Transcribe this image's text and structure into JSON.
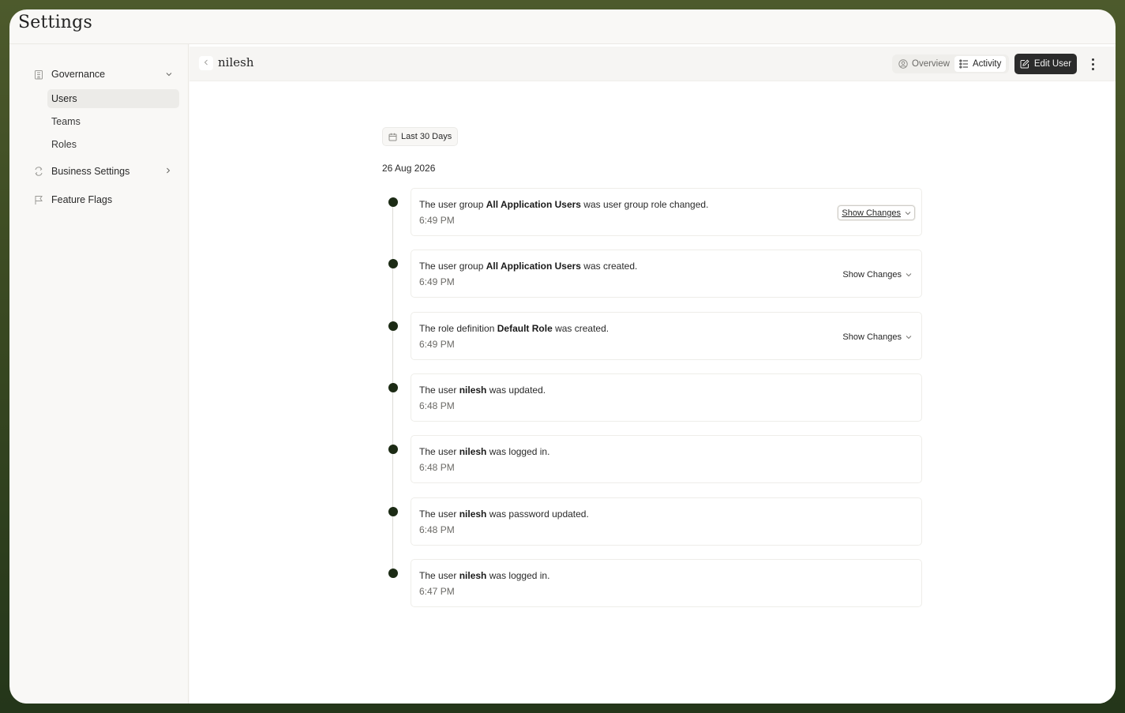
{
  "app": {
    "title": "Settings"
  },
  "sidebar": {
    "governance": {
      "label": "Governance",
      "icon": "building-icon"
    },
    "sub_items": [
      {
        "label": "Users",
        "active": true
      },
      {
        "label": "Teams",
        "active": false
      },
      {
        "label": "Roles",
        "active": false
      }
    ],
    "business_settings": {
      "label": "Business Settings",
      "icon": "refresh-icon"
    },
    "feature_flags": {
      "label": "Feature Flags",
      "icon": "flag-icon"
    }
  },
  "header": {
    "title": "nilesh",
    "tabs": [
      {
        "label": "Overview",
        "icon": "user-circle-icon",
        "active": false
      },
      {
        "label": "Activity",
        "icon": "list-icon",
        "active": true
      }
    ],
    "edit_label": "Edit User"
  },
  "filter": {
    "range_label": "Last 30 Days"
  },
  "activity": {
    "date": "26 Aug 2026",
    "show_changes_label": "Show Changes",
    "events": [
      {
        "pre": "The user group ",
        "bold": "All Application Users",
        "post": " was user group role changed.",
        "time": "6:49 PM",
        "has_changes": true
      },
      {
        "pre": "The user group ",
        "bold": "All Application Users",
        "post": " was created.",
        "time": "6:49 PM",
        "has_changes": true
      },
      {
        "pre": "The role definition ",
        "bold": "Default Role",
        "post": " was created.",
        "time": "6:49 PM",
        "has_changes": true
      },
      {
        "pre": "The user ",
        "bold": "nilesh",
        "post": " was updated.",
        "time": "6:48 PM",
        "has_changes": false
      },
      {
        "pre": "The user ",
        "bold": "nilesh",
        "post": " was logged in.",
        "time": "6:48 PM",
        "has_changes": false
      },
      {
        "pre": "The user ",
        "bold": "nilesh",
        "post": " was password updated.",
        "time": "6:48 PM",
        "has_changes": false
      },
      {
        "pre": "The user ",
        "bold": "nilesh",
        "post": " was logged in.",
        "time": "6:47 PM",
        "has_changes": false
      }
    ]
  },
  "colors": {
    "accent_dark": "#2b2b2b",
    "timeline_dot": "#1c2b15",
    "frame_green": "#3b4a22"
  }
}
